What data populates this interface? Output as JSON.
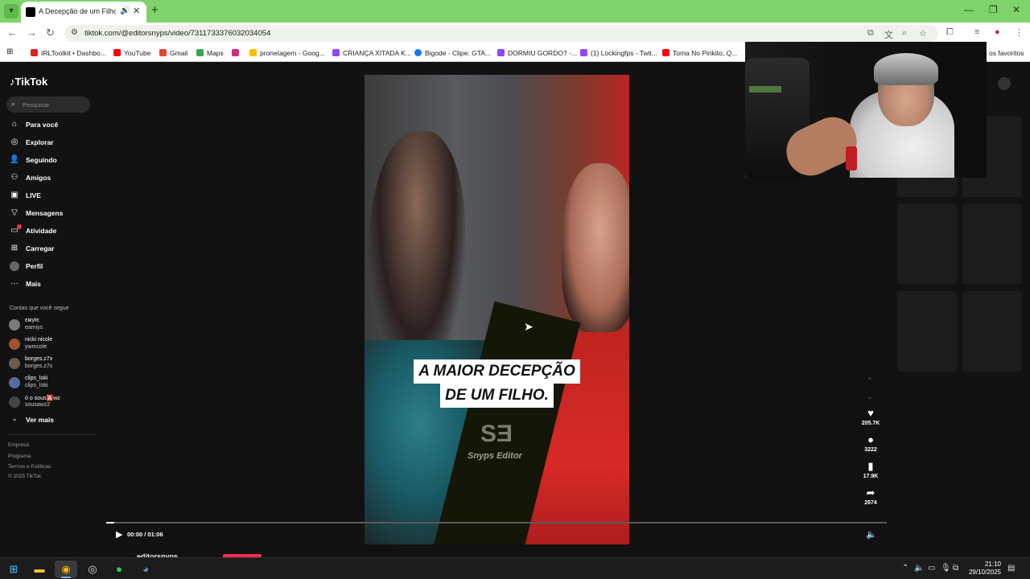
{
  "browser": {
    "tab_title": "A Decepção de um Filho co",
    "url": "tiktok.com/@editorsnyps/video/7311733376032034054",
    "bookmarks": [
      {
        "label": "IRLToolkit • Dashbo...",
        "color": "#e11d1d"
      },
      {
        "label": "YouTube",
        "color": "#ff0000"
      },
      {
        "label": "Gmail",
        "color": "#ea4335"
      },
      {
        "label": "Maps",
        "color": "#34a853"
      },
      {
        "label": "",
        "color": "#d62976"
      },
      {
        "label": "pronetagem - Goog...",
        "color": "#fbbc04"
      },
      {
        "label": "CRIANÇA XITADA K...",
        "color": "#9146ff"
      },
      {
        "label": "Bigode - Clipe: GTA...",
        "color": "#1877f2"
      },
      {
        "label": "DORMIU GORDO? -...",
        "color": "#9146ff"
      },
      {
        "label": "(1) Lockingfps - Twit...",
        "color": "#9146ff"
      },
      {
        "label": "Toma No Pirikito, Q...",
        "color": "#ff0000"
      }
    ],
    "bookmarks_more": "os favoritos"
  },
  "tiktok": {
    "logo": "TikTok",
    "search_placeholder": "Pesquisar",
    "nav": [
      {
        "label": "Para você",
        "icon": "home-icon"
      },
      {
        "label": "Explorar",
        "icon": "compass-icon"
      },
      {
        "label": "Seguindo",
        "icon": "following-icon"
      },
      {
        "label": "Amigos",
        "icon": "friends-icon"
      },
      {
        "label": "LIVE",
        "icon": "live-icon"
      },
      {
        "label": "Mensagens",
        "icon": "messages-icon"
      },
      {
        "label": "Atividade",
        "icon": "activity-icon"
      },
      {
        "label": "Carregar",
        "icon": "upload-icon"
      },
      {
        "label": "Perfil",
        "icon": "profile-icon"
      },
      {
        "label": "Mais",
        "icon": "more-icon"
      }
    ],
    "following_title": "Contas que você segue",
    "following": [
      {
        "name": "ємуℓє",
        "handle": "eamiys",
        "color": "#7a7a7a"
      },
      {
        "name": "nicki nicole",
        "handle": "ywmcole",
        "color": "#a0522d"
      },
      {
        "name": "borges.z7x",
        "handle": "borges.z7x",
        "color": "#6b5b4b"
      },
      {
        "name": "clips_loki",
        "handle": "clips_loki",
        "color": "#5a6aa0"
      },
      {
        "name": "ó o sous🅰️wz",
        "handle": "sousawz2",
        "color": "#444444"
      }
    ],
    "see_more": "Ver mais",
    "footer": [
      "Empresa",
      "Programa",
      "Termos e Políticas",
      "© 2025 TikTok"
    ],
    "video": {
      "caption_line1": "A MAIOR DECEPÇÃO",
      "caption_line2": "DE UM FILHO.",
      "watermark_logo": "SƎ",
      "watermark_text": "Snyps Editor",
      "time": "00:00 / 01:06",
      "likes": "205.7K",
      "comments": "3222",
      "saves": "17.9K",
      "shares": "2674",
      "author": "editorsnyps"
    }
  },
  "taskbar": {
    "time": "21:10",
    "date": "29/10/2025"
  }
}
